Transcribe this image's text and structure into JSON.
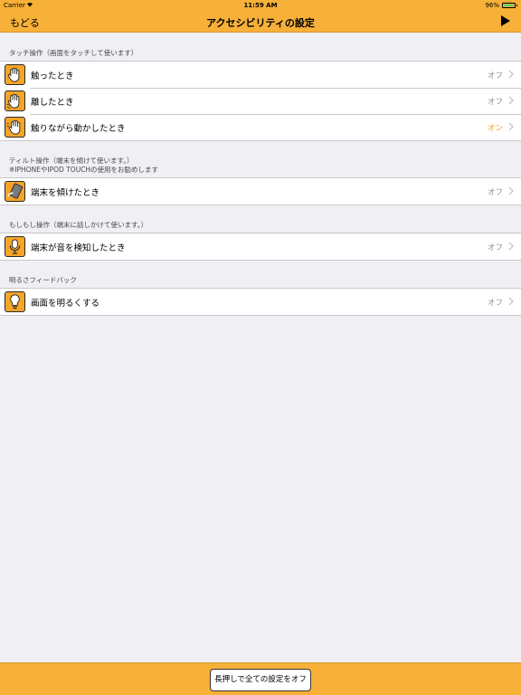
{
  "status_bar": {
    "carrier": "Carrier",
    "time": "11:59 AM",
    "battery": "96%"
  },
  "nav": {
    "back": "もどる",
    "title": "アクセシビリティの設定"
  },
  "sections": {
    "touch": {
      "header": "タッチ操作（画面をタッチして使います）",
      "rows": [
        {
          "label": "触ったとき",
          "value": "オフ",
          "icon": "hand-touch-icon"
        },
        {
          "label": "離したとき",
          "value": "オフ",
          "icon": "hand-release-icon"
        },
        {
          "label": "触りながら動かしたとき",
          "value": "オン",
          "icon": "hand-move-icon"
        }
      ]
    },
    "tilt": {
      "header": "ティルト操作（端末を傾けて使います。）",
      "subheader": "※IPHONEやIPOD TOUCHの使用をお勧めします",
      "rows": [
        {
          "label": "端末を傾けたとき",
          "value": "オフ",
          "icon": "tilt-device-icon"
        }
      ]
    },
    "voice": {
      "header": "もしもし操作（端末に話しかけて使います。）",
      "rows": [
        {
          "label": "端末が音を検知したとき",
          "value": "オフ",
          "icon": "microphone-icon"
        }
      ]
    },
    "brightness": {
      "header": "明るさフィードバック",
      "rows": [
        {
          "label": "画面を明るくする",
          "value": "オフ",
          "icon": "light-bulb-icon"
        }
      ]
    }
  },
  "toolbar": {
    "off_all_label": "長押しで全ての設定をオフ"
  },
  "colors": {
    "accent": "#f7b038",
    "on": "#f0a020",
    "off": "#8e8e93",
    "background": "#efeff4"
  }
}
